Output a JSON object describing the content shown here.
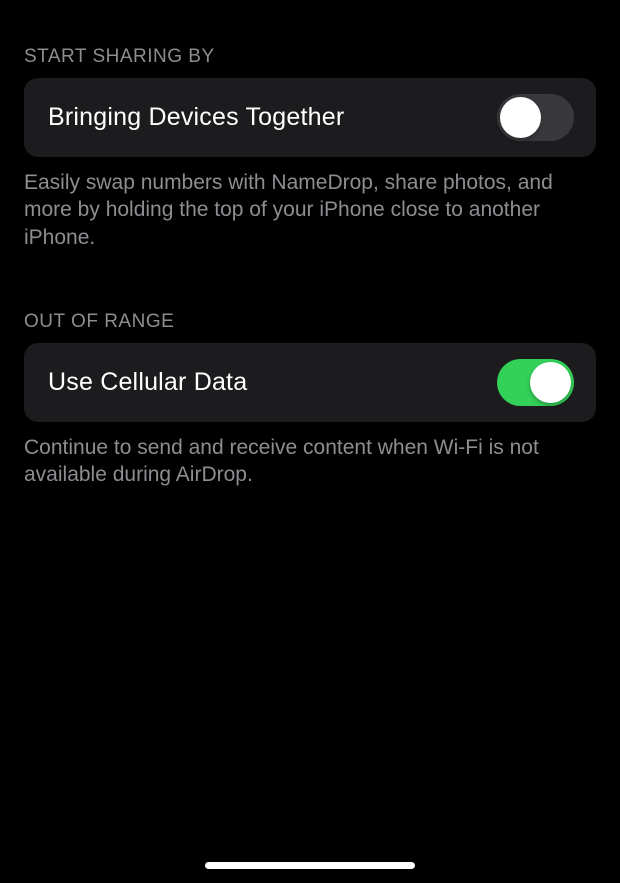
{
  "sections": {
    "startSharing": {
      "header": "Start Sharing By",
      "cell": {
        "label": "Bringing Devices Together",
        "toggleOn": false
      },
      "footer": "Easily swap numbers with NameDrop, share photos, and more by holding the top of your iPhone close to another iPhone."
    },
    "outOfRange": {
      "header": "Out of Range",
      "cell": {
        "label": "Use Cellular Data",
        "toggleOn": true
      },
      "footer": "Continue to send and receive content when Wi-Fi is not available during AirDrop."
    }
  }
}
